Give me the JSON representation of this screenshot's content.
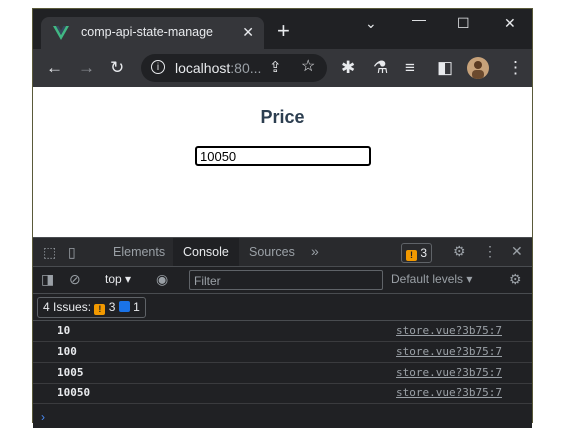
{
  "browser": {
    "tab_title": "comp-api-state-manage",
    "tab_close": "✕",
    "new_tab": "+",
    "url_host": "localhost",
    "url_rest": ":80..."
  },
  "page": {
    "heading": "Price",
    "price_value": "10050"
  },
  "devtools": {
    "tabs": [
      "Elements",
      "Console",
      "Sources"
    ],
    "more_tabs": "»",
    "issues_badge_count": "3",
    "context": "top",
    "filter_placeholder": "Filter",
    "levels": "Default levels",
    "issues_label": "4 Issues:",
    "issues_warn_count": "3",
    "issues_info_count": "1",
    "logs": [
      {
        "value": "10",
        "source": "store.vue?3b75:7"
      },
      {
        "value": "100",
        "source": "store.vue?3b75:7"
      },
      {
        "value": "1005",
        "source": "store.vue?3b75:7"
      },
      {
        "value": "10050",
        "source": "store.vue?3b75:7"
      }
    ],
    "prompt": "›"
  },
  "colors": {
    "accent_vue": "#41b883",
    "warn": "#f29900",
    "info": "#1a73e8"
  }
}
